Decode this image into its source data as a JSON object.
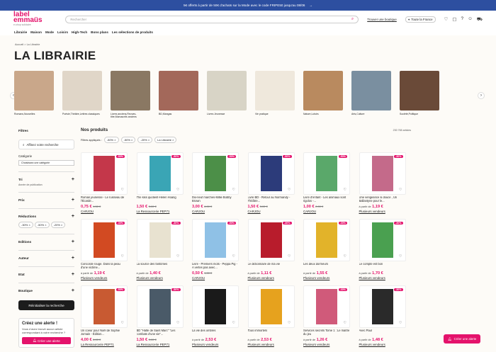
{
  "promo": {
    "text": "5€ offerts à partir de 50€ d'achats sur la Mode avec le code FRIPE50 jusqu'au 08/06",
    "arrow": "→"
  },
  "brand": {
    "logo": "label emmaüs",
    "sub": "e-shop solidaire"
  },
  "search": {
    "placeholder": "Rechercher"
  },
  "header": {
    "find_store": "Trouver une boutique",
    "location": "Toute la France"
  },
  "nav": [
    "Librairie",
    "Maison",
    "Mode",
    "Loisirs",
    "High-Tech",
    "Bons plans",
    "Les sélections de produits"
  ],
  "breadcrumb": "Accueil  >  La Librairie",
  "page_title": "LA LIBRAIRIE",
  "categories": [
    {
      "label": "Romans,Nouvelles",
      "color": "#c9a78a"
    },
    {
      "label": "Poésie,Théâtre,Lettres classiques",
      "color": "#e0d6c8"
    },
    {
      "label": "Livres anciens,Revues-titre,Manuscrits anciens",
      "color": "#8a7863"
    },
    {
      "label": "BD,Mangas",
      "color": "#a3685a"
    },
    {
      "label": "Livres Jeunesse",
      "color": "#d8d4c6"
    },
    {
      "label": "Vie pratique",
      "color": "#efe8dc"
    },
    {
      "label": "Nature,Loisirs",
      "color": "#b98a5f"
    },
    {
      "label": "Arts,Culture",
      "color": "#7a8fa0"
    },
    {
      "label": "Société,Politique",
      "color": "#6a4a38"
    }
  ],
  "filters": {
    "title": "Filtres",
    "search_ph": "Affinez votre recherche",
    "cat_label": "Catégorie",
    "cat_select": "Choisissez une catégorie",
    "sort": "Tri",
    "sort_sub": "Année de publication",
    "price": "Prix",
    "reductions": "Réductions",
    "reduction_chips": [
      "-30%",
      "-50%",
      "-20%"
    ],
    "editions": "Editions",
    "auteur": "Auteur",
    "etat": "Etat",
    "boutique": "Boutique",
    "reset": "Réinitialiser la recherche"
  },
  "alert": {
    "title": "Créez une alerte !",
    "text": "Vous n'avez trouvé aucun article correspondant à votre recherche ?",
    "button": "Créer une alerte"
  },
  "products_header": {
    "title": "Nos produits",
    "count": "230 765 articles",
    "applied_label": "Filtres appliqués :",
    "applied": [
      "-50%",
      "-50%",
      "-20%",
      "La Librairie"
    ]
  },
  "products": [
    {
      "title": "Roman jeunesse - Le ruisseau de l'Écarde...",
      "price": "0,75 €",
      "old": "1,50 €",
      "seller": "CARJOU",
      "disc": "-50%",
      "color": "#c4374a"
    },
    {
      "title": "The kiss quotient-Helen Hoang",
      "price": "1,50 €",
      "old": "3,00 €",
      "seller": "La Ressourcerie PEP71",
      "disc": "-50%",
      "color": "#3aa5b5"
    },
    {
      "title": "Dix-neuf marches-Millie Bobby Brown",
      "price": "3,00 €",
      "old": "6,00 €",
      "seller": "CARJOU",
      "disc": "-50%",
      "color": "#4c8f48"
    },
    {
      "title": "Livre BD - Retour au Normandy - Théâtre...",
      "price": "1,50 €",
      "old": "3,00 €",
      "seller": "CARJOU",
      "disc": "-50%",
      "color": "#2c3b7a"
    },
    {
      "title": "Livre d'enfant - Les animaux sont rigolos -...",
      "price": "1,00 €",
      "old": "2,00 €",
      "seller": "CARJOU",
      "disc": "-50%",
      "color": "#5aa86a"
    },
    {
      "title": "Une vengeance si douce , Un Ballantyne pour le...",
      "price": "1,19 €",
      "prefix": "à partir de",
      "seller": "Plusieurs vendeurs",
      "disc": "-30%",
      "color": "#c46a8a"
    },
    {
      "title": "Concorde rouge. Dans la peau d'une victime...",
      "price": "1,19 €",
      "prefix": "à partir de",
      "seller": "Plusieurs vendeurs",
      "disc": "-30%",
      "color": "#d24a22"
    },
    {
      "title": "La source des fantômes",
      "price": "1,40 €",
      "prefix": "à partir de",
      "seller": "Plusieurs vendeurs",
      "disc": "-30%",
      "color": "#e8e2d0"
    },
    {
      "title": "Livre - Premiers mots - Peppa Pig - A vertes pas avec...",
      "price": "0,50 €",
      "old": "1,00 €",
      "seller": "CARJOU",
      "disc": "-50%",
      "color": "#8fc1e6"
    },
    {
      "title": "Le dictionnaire de ma vie",
      "price": "1,11 €",
      "prefix": "à partir de",
      "seller": "Plusieurs vendeurs",
      "disc": "-30%",
      "color": "#b81c2c"
    },
    {
      "title": "Les deux dormeurs",
      "price": "1,55 €",
      "prefix": "à partir de",
      "seller": "Plusieurs vendeurs",
      "disc": "-30%",
      "color": "#e2b32a"
    },
    {
      "title": "Le compte est bon",
      "price": "1,70 €",
      "prefix": "à partir de",
      "seller": "Plusieurs vendeurs",
      "disc": "-30%",
      "color": "#4aa050"
    },
    {
      "title": "Un coeur pour Noël de Sophie Jomain - Édition...",
      "price": "4,00 €",
      "old": "8,00 €",
      "seller": "La Ressourcerie PEP71",
      "disc": "-50%",
      "color": "#c85a32"
    },
    {
      "title": "BD \"Halte de Saint Marc\" \"Les combats d'une vie\"...",
      "price": "1,50 €",
      "old": "3,00 €",
      "seller": "La Ressourcerie PEP71",
      "disc": "-50%",
      "color": "#4a5a68"
    },
    {
      "title": "La vie des ombres",
      "price": "2,53 €",
      "prefix": "à partir de",
      "seller": "Plusieurs vendeurs",
      "disc": "",
      "color": "#1a1a1a"
    },
    {
      "title": "Tous immortels",
      "price": "2,53 €",
      "prefix": "à partir de",
      "seller": "Plusieurs vendeurs",
      "disc": "",
      "color": "#e6a21e"
    },
    {
      "title": "Services secrets Tome 1 : Le maître du jeu",
      "price": "1,26 €",
      "prefix": "à partir de",
      "seller": "Plusieurs vendeurs",
      "disc": "-30%",
      "color": "#d05a7a"
    },
    {
      "title": "Avec Paul",
      "price": "1,48 €",
      "prefix": "à partir de",
      "seller": "Plusieurs vendeurs",
      "disc": "-30%",
      "color": "#2a2a2a"
    }
  ],
  "fab": "Créer une alerte"
}
